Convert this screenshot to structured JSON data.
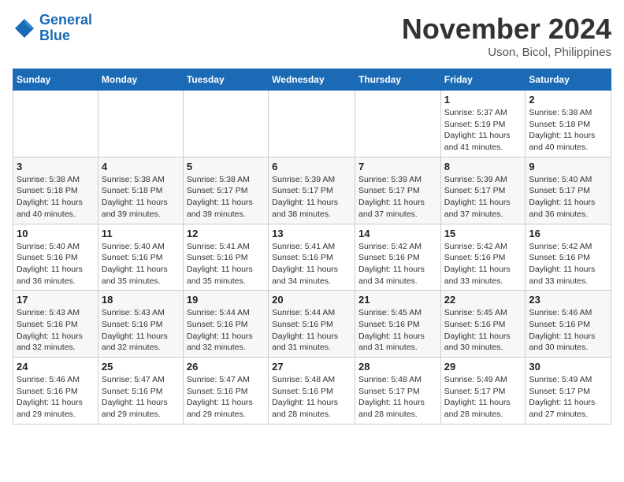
{
  "logo": {
    "line1": "General",
    "line2": "Blue"
  },
  "title": "November 2024",
  "subtitle": "Uson, Bicol, Philippines",
  "weekdays": [
    "Sunday",
    "Monday",
    "Tuesday",
    "Wednesday",
    "Thursday",
    "Friday",
    "Saturday"
  ],
  "weeks": [
    [
      {
        "day": "",
        "info": ""
      },
      {
        "day": "",
        "info": ""
      },
      {
        "day": "",
        "info": ""
      },
      {
        "day": "",
        "info": ""
      },
      {
        "day": "",
        "info": ""
      },
      {
        "day": "1",
        "info": "Sunrise: 5:37 AM\nSunset: 5:19 PM\nDaylight: 11 hours and 41 minutes."
      },
      {
        "day": "2",
        "info": "Sunrise: 5:38 AM\nSunset: 5:18 PM\nDaylight: 11 hours and 40 minutes."
      }
    ],
    [
      {
        "day": "3",
        "info": "Sunrise: 5:38 AM\nSunset: 5:18 PM\nDaylight: 11 hours and 40 minutes."
      },
      {
        "day": "4",
        "info": "Sunrise: 5:38 AM\nSunset: 5:18 PM\nDaylight: 11 hours and 39 minutes."
      },
      {
        "day": "5",
        "info": "Sunrise: 5:38 AM\nSunset: 5:17 PM\nDaylight: 11 hours and 39 minutes."
      },
      {
        "day": "6",
        "info": "Sunrise: 5:39 AM\nSunset: 5:17 PM\nDaylight: 11 hours and 38 minutes."
      },
      {
        "day": "7",
        "info": "Sunrise: 5:39 AM\nSunset: 5:17 PM\nDaylight: 11 hours and 37 minutes."
      },
      {
        "day": "8",
        "info": "Sunrise: 5:39 AM\nSunset: 5:17 PM\nDaylight: 11 hours and 37 minutes."
      },
      {
        "day": "9",
        "info": "Sunrise: 5:40 AM\nSunset: 5:17 PM\nDaylight: 11 hours and 36 minutes."
      }
    ],
    [
      {
        "day": "10",
        "info": "Sunrise: 5:40 AM\nSunset: 5:16 PM\nDaylight: 11 hours and 36 minutes."
      },
      {
        "day": "11",
        "info": "Sunrise: 5:40 AM\nSunset: 5:16 PM\nDaylight: 11 hours and 35 minutes."
      },
      {
        "day": "12",
        "info": "Sunrise: 5:41 AM\nSunset: 5:16 PM\nDaylight: 11 hours and 35 minutes."
      },
      {
        "day": "13",
        "info": "Sunrise: 5:41 AM\nSunset: 5:16 PM\nDaylight: 11 hours and 34 minutes."
      },
      {
        "day": "14",
        "info": "Sunrise: 5:42 AM\nSunset: 5:16 PM\nDaylight: 11 hours and 34 minutes."
      },
      {
        "day": "15",
        "info": "Sunrise: 5:42 AM\nSunset: 5:16 PM\nDaylight: 11 hours and 33 minutes."
      },
      {
        "day": "16",
        "info": "Sunrise: 5:42 AM\nSunset: 5:16 PM\nDaylight: 11 hours and 33 minutes."
      }
    ],
    [
      {
        "day": "17",
        "info": "Sunrise: 5:43 AM\nSunset: 5:16 PM\nDaylight: 11 hours and 32 minutes."
      },
      {
        "day": "18",
        "info": "Sunrise: 5:43 AM\nSunset: 5:16 PM\nDaylight: 11 hours and 32 minutes."
      },
      {
        "day": "19",
        "info": "Sunrise: 5:44 AM\nSunset: 5:16 PM\nDaylight: 11 hours and 32 minutes."
      },
      {
        "day": "20",
        "info": "Sunrise: 5:44 AM\nSunset: 5:16 PM\nDaylight: 11 hours and 31 minutes."
      },
      {
        "day": "21",
        "info": "Sunrise: 5:45 AM\nSunset: 5:16 PM\nDaylight: 11 hours and 31 minutes."
      },
      {
        "day": "22",
        "info": "Sunrise: 5:45 AM\nSunset: 5:16 PM\nDaylight: 11 hours and 30 minutes."
      },
      {
        "day": "23",
        "info": "Sunrise: 5:46 AM\nSunset: 5:16 PM\nDaylight: 11 hours and 30 minutes."
      }
    ],
    [
      {
        "day": "24",
        "info": "Sunrise: 5:46 AM\nSunset: 5:16 PM\nDaylight: 11 hours and 29 minutes."
      },
      {
        "day": "25",
        "info": "Sunrise: 5:47 AM\nSunset: 5:16 PM\nDaylight: 11 hours and 29 minutes."
      },
      {
        "day": "26",
        "info": "Sunrise: 5:47 AM\nSunset: 5:16 PM\nDaylight: 11 hours and 29 minutes."
      },
      {
        "day": "27",
        "info": "Sunrise: 5:48 AM\nSunset: 5:16 PM\nDaylight: 11 hours and 28 minutes."
      },
      {
        "day": "28",
        "info": "Sunrise: 5:48 AM\nSunset: 5:17 PM\nDaylight: 11 hours and 28 minutes."
      },
      {
        "day": "29",
        "info": "Sunrise: 5:49 AM\nSunset: 5:17 PM\nDaylight: 11 hours and 28 minutes."
      },
      {
        "day": "30",
        "info": "Sunrise: 5:49 AM\nSunset: 5:17 PM\nDaylight: 11 hours and 27 minutes."
      }
    ]
  ]
}
